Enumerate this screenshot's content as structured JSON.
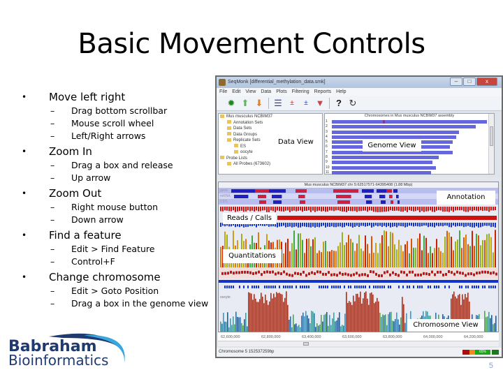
{
  "slide": {
    "title": "Basic Movement Controls",
    "page_number": "5",
    "bullets": [
      {
        "label": "Move left right",
        "sub": [
          "Drag bottom scrollbar",
          "Mouse scroll wheel",
          "Left/Right arrows"
        ]
      },
      {
        "label": "Zoom In",
        "sub": [
          "Drag a box and release",
          "Up arrow"
        ]
      },
      {
        "label": "Zoom Out",
        "sub": [
          "Right mouse button",
          "Down arrow"
        ]
      },
      {
        "label": "Find a feature",
        "sub": [
          "Edit > Find Feature",
          "Control+F"
        ]
      },
      {
        "label": "Change chromosome",
        "sub": [
          "Edit > Goto Position",
          "Drag a box in the genome view"
        ]
      }
    ],
    "logo": {
      "line1": "Babraham",
      "line2": "Bioinformatics",
      "color": "#1f3a6e",
      "swoosh_color": "#3aa6dd"
    }
  },
  "app": {
    "window_title": "SeqMonk [differential_methylation_data.smk]",
    "window_buttons": [
      "–",
      "□",
      "x"
    ],
    "menu": [
      "File",
      "Edit",
      "View",
      "Data",
      "Plots",
      "Filtering",
      "Reports",
      "Help"
    ],
    "toolbar_icons": [
      "new-project-icon",
      "upload-icon",
      "download-icon",
      "sliders-icon",
      "compare-plus-minus-icon",
      "compare-plus-minus-alt-icon",
      "filter-funnel-icon",
      "help-icon",
      "refresh-icon"
    ],
    "data_view": {
      "overlay_label": "Data View",
      "tree": [
        {
          "label": "Mus musculus NCBIM37",
          "level": 0
        },
        {
          "label": "Annotation Sets",
          "level": 1
        },
        {
          "label": "Data Sets",
          "level": 1
        },
        {
          "label": "Data Groups",
          "level": 1
        },
        {
          "label": "Replicate Sets",
          "level": 1
        },
        {
          "label": "ES",
          "level": 2
        },
        {
          "label": "oocyte",
          "level": 2
        },
        {
          "label": "Probe Lists",
          "level": 0
        },
        {
          "label": "All Probes (673602)",
          "level": 1
        }
      ]
    },
    "genome_view": {
      "overlay_label": "Genome View",
      "header": "Chromosomes in Mus musculus NCBIM37 assembly",
      "chromosomes": [
        "1",
        "2",
        "3",
        "4",
        "5",
        "6",
        "7",
        "8",
        "9",
        "10",
        "11"
      ],
      "relative_lengths": [
        1.0,
        0.93,
        0.82,
        0.8,
        0.78,
        0.76,
        0.78,
        0.69,
        0.65,
        0.67,
        0.64
      ],
      "bar_color": "#6666dd",
      "marker_color": "#a0205a"
    },
    "chromosome_view": {
      "header": "Mus musculus NCBIM37 chr 5:62517571-64395408 (1.88 Mbp)",
      "annotation_tracks": [
        "gene",
        "mRNA",
        "CDS"
      ],
      "annotation_label": "Annotation",
      "reads_label": "Reads / Calls",
      "quantitations_label": "Quantitations",
      "chromosome_view_label": "Chromosome View",
      "track_labels": [
        "ES",
        "oocyte"
      ],
      "axis_ticks": [
        "62,600,000",
        "62,800,000",
        "63,400,000",
        "63,600,000",
        "63,800,000",
        "64,000,000",
        "64,200,000"
      ]
    },
    "status_bar": {
      "text": "Chromosome 5 152537259bp",
      "memory_label": "65%",
      "memory_colors": [
        "#b00e0e",
        "#f08a1a",
        "#18a818"
      ]
    }
  }
}
